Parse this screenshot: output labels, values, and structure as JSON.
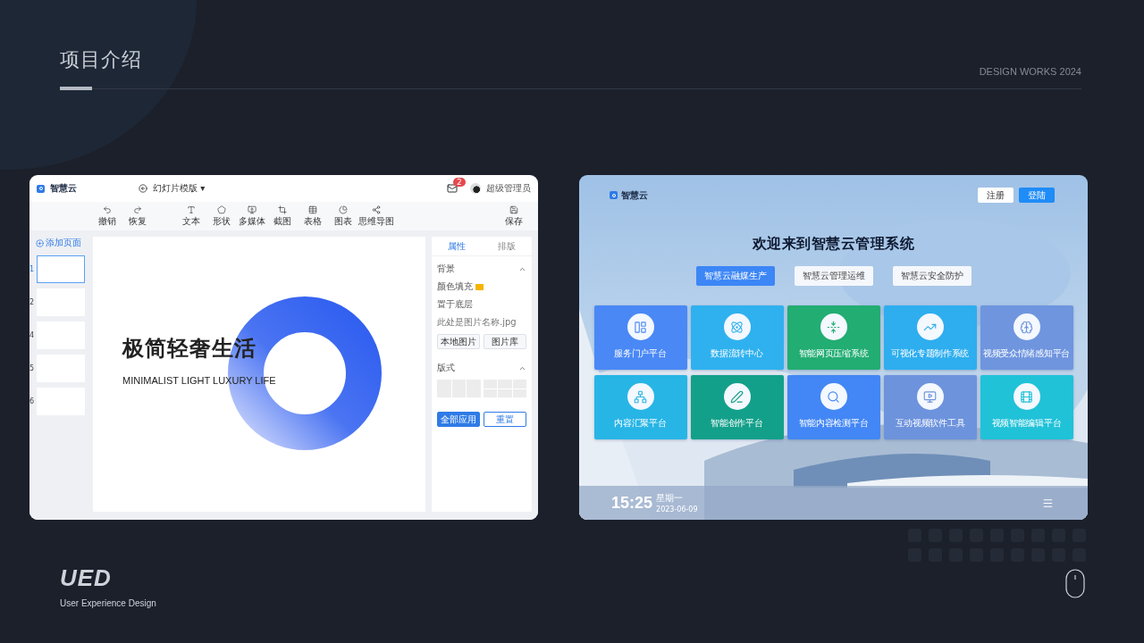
{
  "header": {
    "title": "项目介绍",
    "tagline": "DESIGN WORKS 2024"
  },
  "editor": {
    "brand": "智慧云",
    "doc_title": "幻灯片模版 ▾",
    "notification_count": "2",
    "user": "超级管理员",
    "toolbar": [
      {
        "label": "撤销"
      },
      {
        "label": "恢复"
      },
      {
        "label": "文本"
      },
      {
        "label": "形状"
      },
      {
        "label": "多媒体"
      },
      {
        "label": "截图"
      },
      {
        "label": "表格"
      },
      {
        "label": "图表"
      },
      {
        "label": "思维导图"
      },
      {
        "label": "保存"
      }
    ],
    "add_page": "添加页面",
    "slides": [
      {
        "number": "1",
        "selected": true
      },
      {
        "number": "2",
        "selected": false
      },
      {
        "number": "4",
        "selected": false
      },
      {
        "number": "5",
        "selected": false
      },
      {
        "number": "6",
        "selected": false
      }
    ],
    "canvas": {
      "headline": "极简轻奢生活",
      "subtitle": "MINIMALIST LIGHT LUXURY LIFE"
    },
    "panel": {
      "tabs": [
        {
          "label": "属性",
          "selected": true
        },
        {
          "label": "排版",
          "selected": false
        }
      ],
      "background_section": "背景",
      "fill_label": "颜色填充",
      "image_label": "置于底层",
      "image_name": "此处是图片名称.jpg",
      "image_buttons": [
        "本地图片",
        "图片库"
      ],
      "layout_section": "版式",
      "apply": "全部应用",
      "reset": "重置"
    }
  },
  "portal": {
    "brand": "智慧云",
    "register": "注册",
    "login": "登陆",
    "headline": "欢迎来到智慧云管理系统",
    "tabs": [
      {
        "label": "智慧云融媒生产",
        "selected": true
      },
      {
        "label": "智慧云管理运维",
        "selected": false
      },
      {
        "label": "智慧云安全防护",
        "selected": false
      }
    ],
    "tiles": [
      {
        "label": "服务门户平台",
        "color": "#4a88f6"
      },
      {
        "label": "数据流转中心",
        "color": "#2fb1ef"
      },
      {
        "label": "智能网页压缩系统",
        "color": "#22ad72"
      },
      {
        "label": "可视化专题制作系统",
        "color": "#2eaeef"
      },
      {
        "label": "视频受众情绪感知平台",
        "color": "#6f95df"
      },
      {
        "label": "内容汇聚平台",
        "color": "#27b5e6"
      },
      {
        "label": "智能创作平台",
        "color": "#13a08a"
      },
      {
        "label": "智能内容检测平台",
        "color": "#4287f5"
      },
      {
        "label": "互动视频软件工具",
        "color": "#6d93dd"
      },
      {
        "label": "视频智能编辑平台",
        "color": "#20c2d8"
      }
    ],
    "time": "15:25",
    "weekday": "星期一",
    "date": "2023-06-09"
  },
  "footer": {
    "logo": "UED",
    "subtitle": "User Experience Design"
  }
}
